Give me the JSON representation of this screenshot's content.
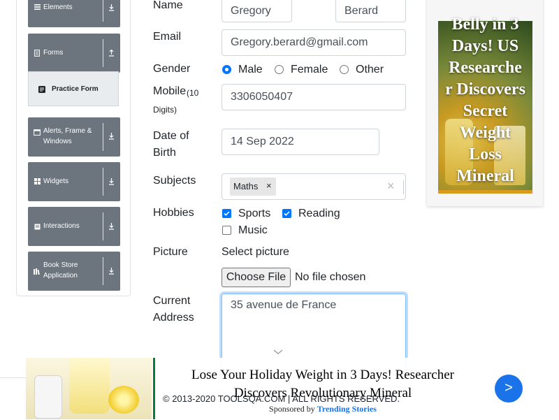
{
  "sidebar": {
    "groups": [
      {
        "label": "Elements",
        "icon": "list-icon",
        "expanded": false
      },
      {
        "label": "Forms",
        "icon": "document-icon",
        "expanded": true
      },
      {
        "label": "Alerts, Frame & Windows",
        "icon": "window-icon",
        "expanded": false
      },
      {
        "label": "Widgets",
        "icon": "grid-icon",
        "expanded": false
      },
      {
        "label": "Interactions",
        "icon": "interactions-icon",
        "expanded": false
      },
      {
        "label": "Book Store Application",
        "icon": "book-icon",
        "expanded": false
      }
    ],
    "active_item": {
      "label": "Practice Form",
      "icon": "form-icon"
    }
  },
  "form": {
    "name": {
      "label": "Name",
      "first": "Gregory",
      "last": "Berard"
    },
    "email": {
      "label": "Email",
      "value": "Gregory.berard@gmail.com"
    },
    "gender": {
      "label": "Gender",
      "options": [
        "Male",
        "Female",
        "Other"
      ],
      "selected": "Male"
    },
    "mobile": {
      "label": "Mobile",
      "hint": "(10 Digits)",
      "value": "3306050407"
    },
    "dob": {
      "label_line1": "Date of",
      "label_line2": "Birth",
      "value": "14 Sep 2022"
    },
    "subjects": {
      "label": "Subjects",
      "chips": [
        "Maths"
      ],
      "chip_remove": "×",
      "clear": "×"
    },
    "hobbies": {
      "label": "Hobbies",
      "options": [
        {
          "label": "Sports",
          "checked": true
        },
        {
          "label": "Reading",
          "checked": true
        },
        {
          "label": "Music",
          "checked": false
        }
      ]
    },
    "picture": {
      "label": "Picture",
      "prompt": "Select picture",
      "button": "Choose File",
      "status": "No file chosen"
    },
    "address": {
      "label_line1": "Current",
      "label_line2": "Address",
      "value": "35 avenue de France"
    }
  },
  "side_ad": {
    "headline_lines": [
      "Belly in 3",
      "Days! US",
      "Researche",
      "r Discovers",
      "Secret",
      "Weight",
      "Loss",
      "Mineral"
    ]
  },
  "footer": {
    "copyright": "© 2013-2020 TOOLSQA.COM | ALL RIGHTS RESERVED."
  },
  "bottom_ad": {
    "title": "Lose Your Holiday Weight in 3 Days! Researcher Discovers Revolutionary Mineral",
    "sponsored_prefix": "Sponsored by",
    "sponsor": "Trending Stories",
    "next": ">"
  },
  "colors": {
    "accent": "#0075ff",
    "sidebar_group": "#6c757d",
    "focus_border": "#80bdff",
    "ad_button": "#1a73e8"
  }
}
